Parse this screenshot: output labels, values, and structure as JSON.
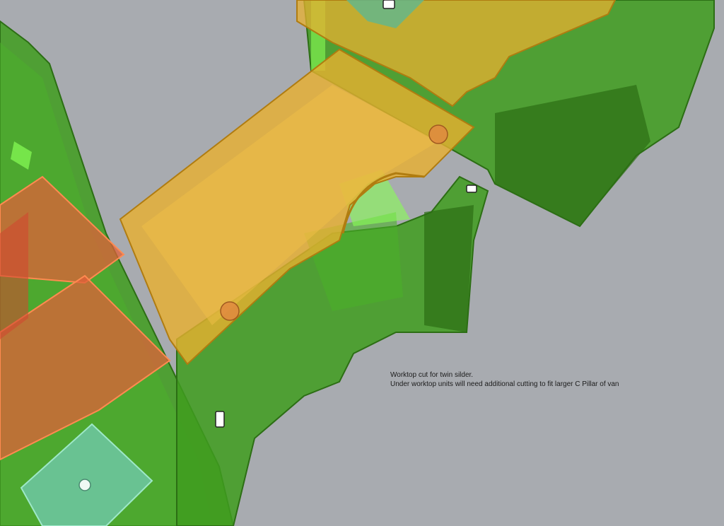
{
  "annotation": {
    "line1": "Worktop cut for twin silder.",
    "line2": "Under worktop units will need additional cutting to fit larger C Pillar of van"
  },
  "colors": {
    "background": "#a8abb0",
    "cabinet_green": "#3f9c1f",
    "cabinet_dark": "#2c6e14",
    "worktop_orange": "#e8b030",
    "panel_red": "#e0603a",
    "sink_teal": "#6fc7a3"
  },
  "icons": {
    "sink": "sink-icon",
    "hinge": "hinge-icon"
  }
}
